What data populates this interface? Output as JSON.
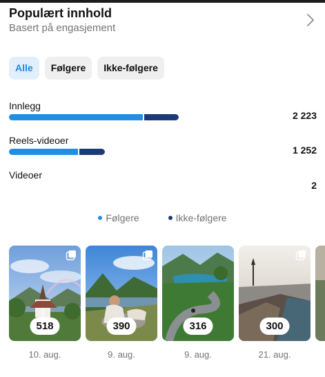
{
  "header": {
    "title": "Populært innhold",
    "subtitle": "Basert på engasjement"
  },
  "filters": [
    {
      "label": "Alle",
      "active": true
    },
    {
      "label": "Følgere",
      "active": false
    },
    {
      "label": "Ikke-følgere",
      "active": false
    }
  ],
  "metrics": [
    {
      "label": "Innlegg",
      "value": "2 223",
      "followers_fraction": 0.79,
      "nonfollowers_fraction": 0.21
    },
    {
      "label": "Reels-videoer",
      "value": "1 252",
      "followers_fraction": 0.72,
      "nonfollowers_fraction": 0.28
    },
    {
      "label": "Videoer",
      "value": "2",
      "followers_fraction": 0,
      "nonfollowers_fraction": 0
    }
  ],
  "legend": {
    "followers": "Følgere",
    "nonfollowers": "Ikke-følgere"
  },
  "colors": {
    "followers": "#1f8fe5",
    "nonfollowers": "#1a3a78",
    "chip_active_bg": "#e1effd",
    "chip_active_text": "#1e88e5"
  },
  "posts": [
    {
      "count": "518",
      "date": "10. aug."
    },
    {
      "count": "390",
      "date": "9. aug."
    },
    {
      "count": "316",
      "date": "9. aug."
    },
    {
      "count": "300",
      "date": "21. aug."
    }
  ]
}
